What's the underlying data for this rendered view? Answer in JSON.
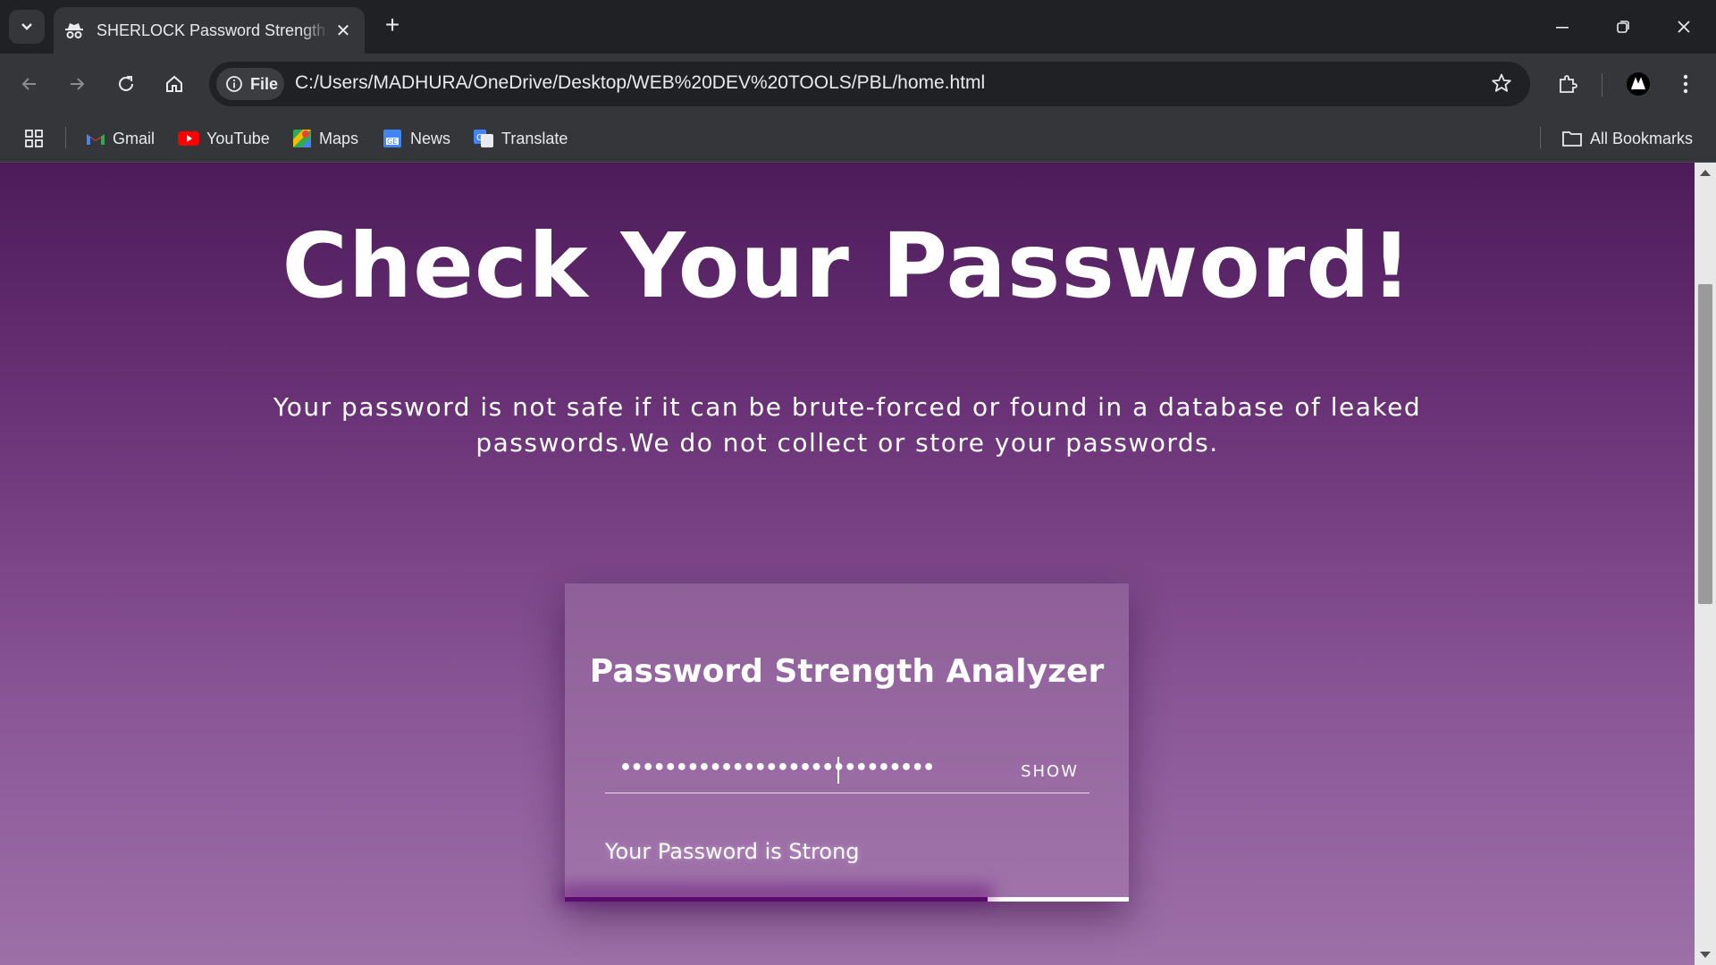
{
  "browser": {
    "tab_title": "SHERLOCK Password Strength Analyzer",
    "url_chip": "File",
    "url": "C:/Users/MADHURA/OneDrive/Desktop/WEB%20DEV%20TOOLS/PBL/home.html",
    "bookmarks": [
      "Gmail",
      "YouTube",
      "Maps",
      "News",
      "Translate"
    ],
    "all_bookmarks": "All Bookmarks"
  },
  "page": {
    "title": "Check Your Password!",
    "subtitle": "Your password is not safe if it can be brute-forced or found in a database of leaked passwords.We do not collect or store your passwords."
  },
  "analyzer": {
    "heading": "Password Strength Analyzer",
    "password_masked": "••••••••••••••••••••••••••••",
    "show_label": "SHOW",
    "strength_message": "Your Password is Strong",
    "strength_level": 0.75,
    "strength_color": "#5b0a6e"
  },
  "colors": {
    "gradient_top": "#4d1b5a",
    "gradient_bottom": "#9d70a8",
    "card": "#9466a0"
  }
}
